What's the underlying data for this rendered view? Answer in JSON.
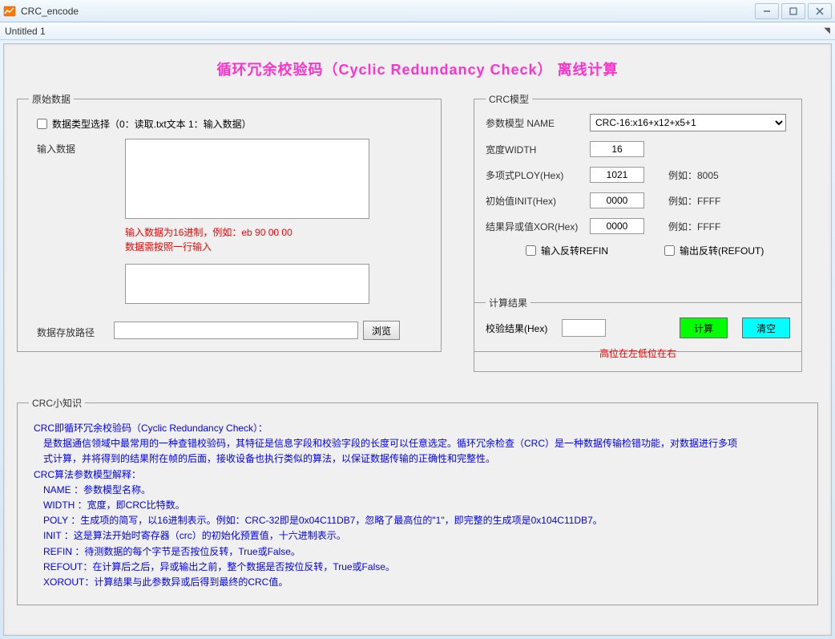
{
  "window": {
    "title": "CRC_encode",
    "menu_tab": "Untitled 1"
  },
  "main_title": "循环冗余校验码（Cyclic Redundancy Check） 离线计算",
  "raw_data": {
    "legend": "原始数据",
    "data_type_label": "数据类型选择（0：读取.txt文本  1：输入数据）",
    "input_data_label": "输入数据",
    "input_hint_line1": "输入数据为16进制，例如：eb 90 00 00",
    "input_hint_line2": "数据需按照一行输入",
    "path_label": "数据存放路径",
    "browse_btn": "浏览"
  },
  "crc_model": {
    "legend": "CRC模型",
    "name_label": "参数模型 NAME",
    "name_value": "CRC-16:x16+x12+x5+1",
    "width_label": "宽度WIDTH",
    "width_value": "16",
    "poly_label": "多项式PLOY(Hex)",
    "poly_value": "1021",
    "poly_example": "例如：8005",
    "init_label": "初始值INIT(Hex)",
    "init_value": "0000",
    "init_example": "例如：FFFF",
    "xor_label": "结果异或值XOR(Hex)",
    "xor_value": "0000",
    "xor_example": "例如：FFFF",
    "refin_label": "输入反转REFIN",
    "refout_label": "输出反转(REFOUT)"
  },
  "result": {
    "legend": "计算结果",
    "check_label": "校验结果(Hex)",
    "calc_btn": "计算",
    "clear_btn": "清空",
    "hint": "高位在左低位在右"
  },
  "knowledge": {
    "legend": "CRC小知识",
    "line1": "CRC即循环冗余校验码（Cyclic Redundancy Check）：",
    "line2": "是数据通信领域中最常用的一种查错校验码，其特征是信息字段和校验字段的长度可以任意选定。循环冗余检查（CRC）是一种数据传输检错功能，对数据进行多项",
    "line3": "式计算，并将得到的结果附在帧的后面，接收设备也执行类似的算法，以保证数据传输的正确性和完整性。",
    "line4": "CRC算法参数模型解释：",
    "line5": "NAME ：参数模型名称。",
    "line6": "WIDTH ：宽度，即CRC比特数。",
    "line7": "POLY ：生成项的简写，以16进制表示。例如：CRC-32即是0x04C11DB7，忽略了最高位的\"1\"，即完整的生成项是0x104C11DB7。",
    "line8": "INIT ：这是算法开始时寄存器（crc）的初始化预置值，十六进制表示。",
    "line9": "REFIN ：待测数据的每个字节是否按位反转，True或False。",
    "line10": "REFOUT：在计算后之后，异或输出之前，整个数据是否按位反转，True或False。",
    "line11": "XOROUT：计算结果与此参数异或后得到最终的CRC值。"
  }
}
